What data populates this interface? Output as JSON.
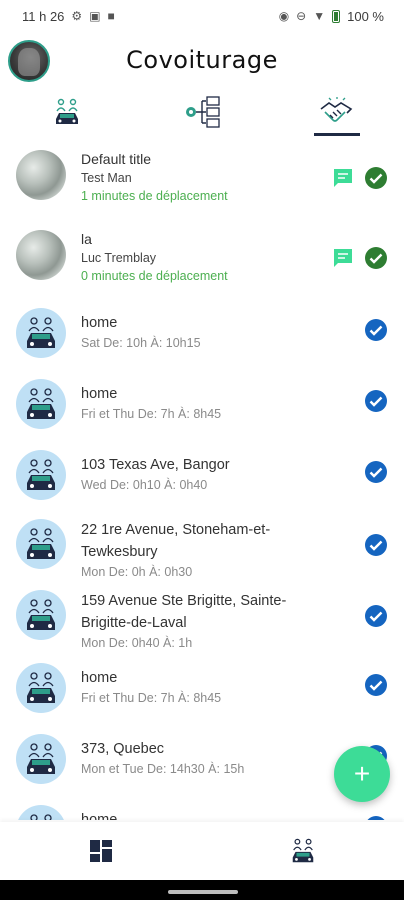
{
  "status_bar": {
    "time": "11 h 26",
    "battery": "100 %",
    "icons": [
      "settings-notification-icon",
      "photo-icon",
      "camera-icon",
      "eye-icon",
      "dnd-icon",
      "wifi-icon",
      "battery-icon"
    ]
  },
  "header": {
    "title": "Covoiturage",
    "avatar": "profile-avatar"
  },
  "tabs": [
    {
      "icon": "carpool-icon",
      "active": false
    },
    {
      "icon": "manage-network-icon",
      "active": false
    },
    {
      "icon": "handshake-icon",
      "active": true
    }
  ],
  "requests": [
    {
      "title": "Default title",
      "name": "Test Man",
      "duration": "1 minutes de déplacement"
    },
    {
      "title": "la",
      "name": "Luc Tremblay",
      "duration": "0 minutes de déplacement"
    }
  ],
  "trips": [
    {
      "place": "home",
      "schedule": "Sat De:  10h À:  10h15"
    },
    {
      "place": "home",
      "schedule": "Fri et Thu De:  7h À:  8h45"
    },
    {
      "place": "103 Texas Ave, Bangor",
      "schedule": "Wed De:  0h10 À:  0h40"
    },
    {
      "place": "22 1re Avenue, Stoneham-et-Tewkesbury",
      "schedule": "Mon De:  0h À:  0h30"
    },
    {
      "place": "159 Avenue Ste Brigitte, Sainte-Brigitte-de-Laval",
      "schedule": "Mon De:  0h40 À:  1h"
    },
    {
      "place": "home",
      "schedule": "Fri et Thu De:  7h À:  8h45"
    },
    {
      "place": "373, Quebec",
      "schedule": "Mon et Tue De:  14h30 À:  15h"
    },
    {
      "place": "home",
      "schedule": ""
    }
  ],
  "fab": {
    "label": "+"
  },
  "bottom_nav": [
    {
      "icon": "dashboard-icon"
    },
    {
      "icon": "carpool-icon"
    }
  ],
  "colors": {
    "accent": "#3ddc97",
    "check_green": "#2e7d32",
    "check_blue": "#1565c0",
    "chat": "#3ddc97",
    "duration_green": "#4caf50",
    "navy": "#1f2a44",
    "teal": "#2e9e8a"
  }
}
